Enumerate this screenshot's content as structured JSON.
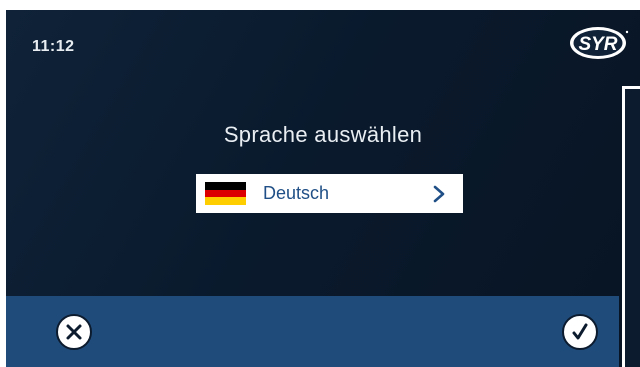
{
  "status": {
    "time": "11:12"
  },
  "brand": {
    "logo_text": "SYR"
  },
  "screen": {
    "title": "Sprache auswählen"
  },
  "language_select": {
    "selected_label": "Deutsch",
    "flag_icon": "germany-flag-icon"
  },
  "actions": {
    "cancel_icon": "close-icon",
    "confirm_icon": "checkmark-icon"
  },
  "colors": {
    "background": "#0a1a2d",
    "bottom_bar": "#1f4b7a",
    "accent_text": "#1f4f86"
  }
}
